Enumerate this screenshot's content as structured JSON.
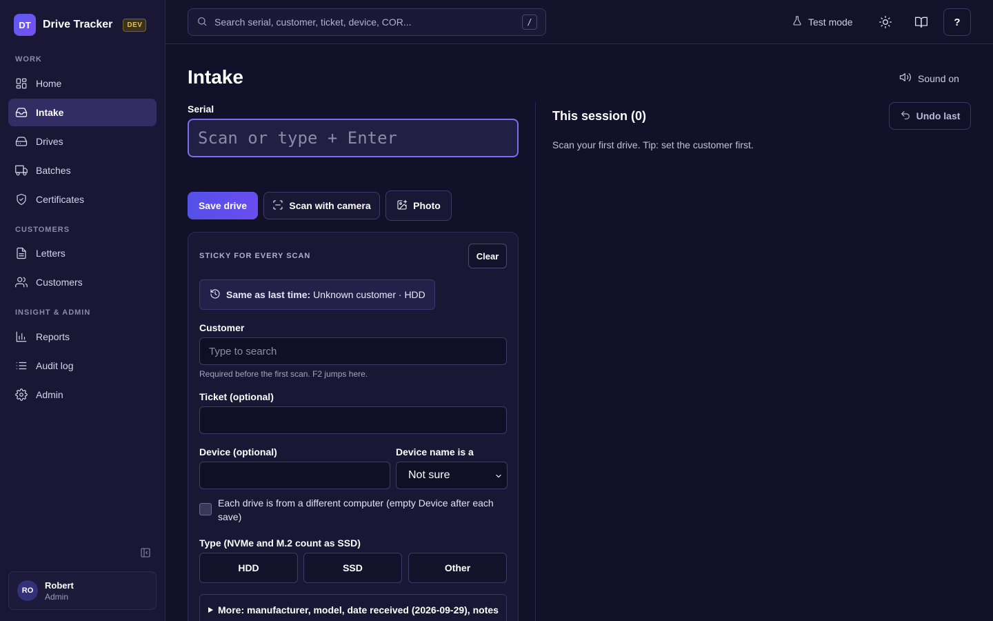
{
  "app": {
    "logo": "DT",
    "name": "Drive Tracker",
    "env_badge": "DEV"
  },
  "sidebar": {
    "sections": [
      {
        "label": "WORK"
      },
      {
        "label": "CUSTOMERS"
      },
      {
        "label": "INSIGHT & ADMIN"
      }
    ],
    "items": [
      {
        "label": "Home",
        "icon": "grid-icon",
        "active": false
      },
      {
        "label": "Intake",
        "icon": "inbox-icon",
        "active": true
      },
      {
        "label": "Drives",
        "icon": "hard-drive-icon",
        "active": false
      },
      {
        "label": "Batches",
        "icon": "truck-icon",
        "active": false
      },
      {
        "label": "Certificates",
        "icon": "shield-check-icon",
        "active": false
      },
      {
        "label": "Letters",
        "icon": "file-text-icon",
        "active": false
      },
      {
        "label": "Customers",
        "icon": "users-icon",
        "active": false
      },
      {
        "label": "Reports",
        "icon": "bar-chart-icon",
        "active": false
      },
      {
        "label": "Audit log",
        "icon": "list-icon",
        "active": false
      },
      {
        "label": "Admin",
        "icon": "gear-icon",
        "active": false
      }
    ],
    "user": {
      "initials": "RO",
      "name": "Robert",
      "role": "Admin"
    }
  },
  "topbar": {
    "search_placeholder": "Search serial, customer, ticket, device, COR...",
    "search_shortcut": "/",
    "test_mode_label": "Test mode",
    "help_label": "?"
  },
  "main": {
    "title": "Intake",
    "sound_label": "Sound on",
    "serial_label": "Serial",
    "serial_placeholder": "Scan or type + Enter",
    "buttons": {
      "save": "Save drive",
      "scan_camera": "Scan with camera",
      "photo": "Photo"
    },
    "sticky": {
      "label": "STICKY FOR EVERY SCAN",
      "clear": "Clear",
      "same_prefix": "Same as last time:",
      "same_value": "Unknown customer · HDD",
      "customer_label": "Customer",
      "customer_placeholder": "Type to search",
      "customer_hint": "Required before the first scan. F2 jumps here.",
      "ticket_label": "Ticket (optional)",
      "device_label": "Device (optional)",
      "device_kind_label": "Device name is a",
      "device_kind_value": "Not sure",
      "different_computer": "Each drive is from a different computer (empty Device after each save)",
      "type_label": "Type (NVMe and M.2 count as SSD)",
      "types": [
        "HDD",
        "SSD",
        "Other"
      ],
      "more": "More: manufacturer, model, date received (2026-09-29), notes"
    },
    "session": {
      "title": "This session (0)",
      "undo": "Undo last",
      "empty": "Scan your first drive. Tip: set the customer first."
    }
  }
}
